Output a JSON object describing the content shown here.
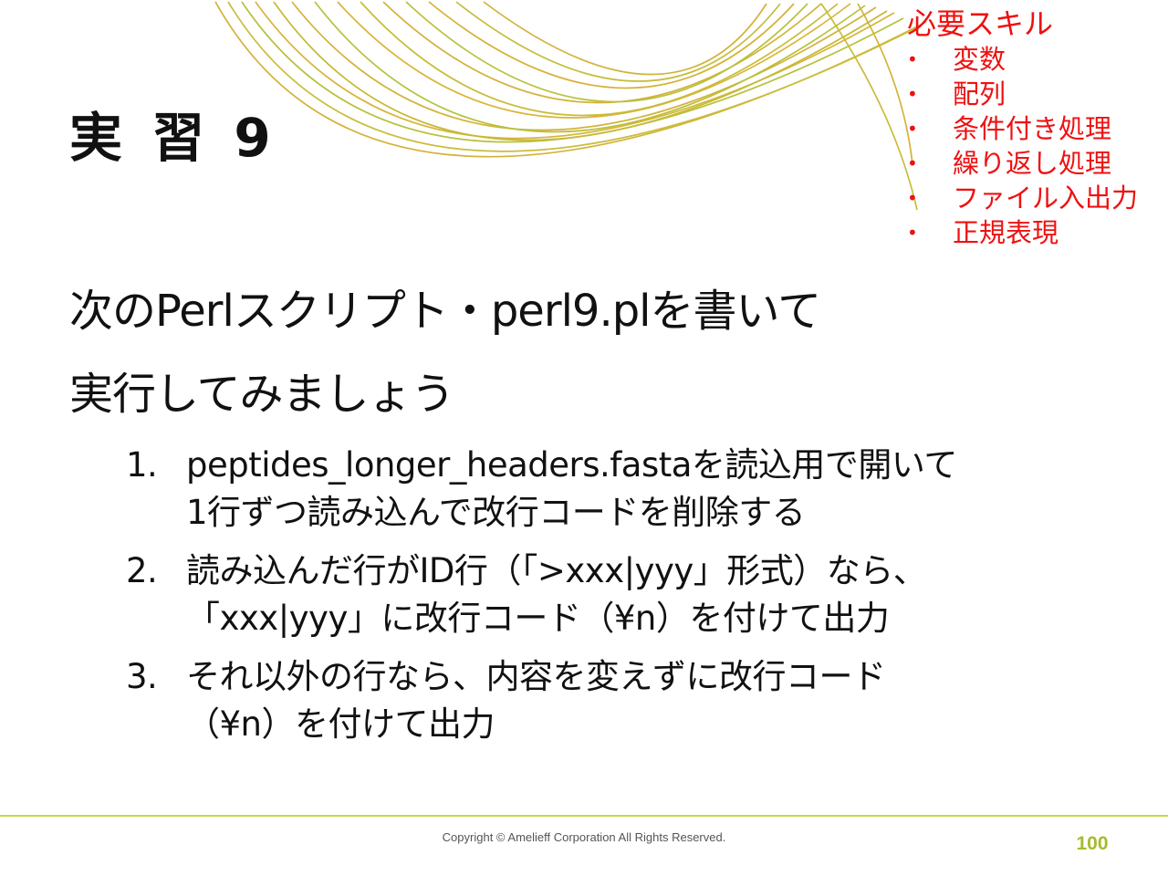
{
  "slide": {
    "title": "実 習 9",
    "skills": {
      "heading": "必要スキル",
      "bullet": "•",
      "items": [
        "変数",
        "配列",
        "条件付き処理",
        "繰り返し処理",
        "ファイル入出力",
        "正規表現"
      ]
    },
    "intro": {
      "lines": [
        "次のPerlスクリプト・perl9.plを書いて",
        "実行してみましょう"
      ]
    },
    "steps": [
      {
        "number": "1.",
        "lines": [
          "peptides_longer_headers.fastaを読込用で開いて",
          "1行ずつ読み込んで改行コードを削除する"
        ]
      },
      {
        "number": "2.",
        "lines": [
          "読み込んだ行がID行（「>xxx|yyy」形式）なら、",
          "「xxx|yyy」に改行コード（¥n）を付けて出力"
        ]
      },
      {
        "number": "3.",
        "lines": [
          "それ以外の行なら、内容を変えずに改行コード",
          "（¥n）を付けて出力"
        ]
      }
    ],
    "footer": {
      "copyright": "Copyright © Amelieff Corporation All Rights Reserved.",
      "page_number": "100"
    }
  },
  "colors": {
    "skills_text": "#ee1111",
    "arc_gold": "#d4b238",
    "arc_green": "#b6c13a",
    "footer_rule": "#c8d846",
    "page_number": "#a7bb2b"
  }
}
